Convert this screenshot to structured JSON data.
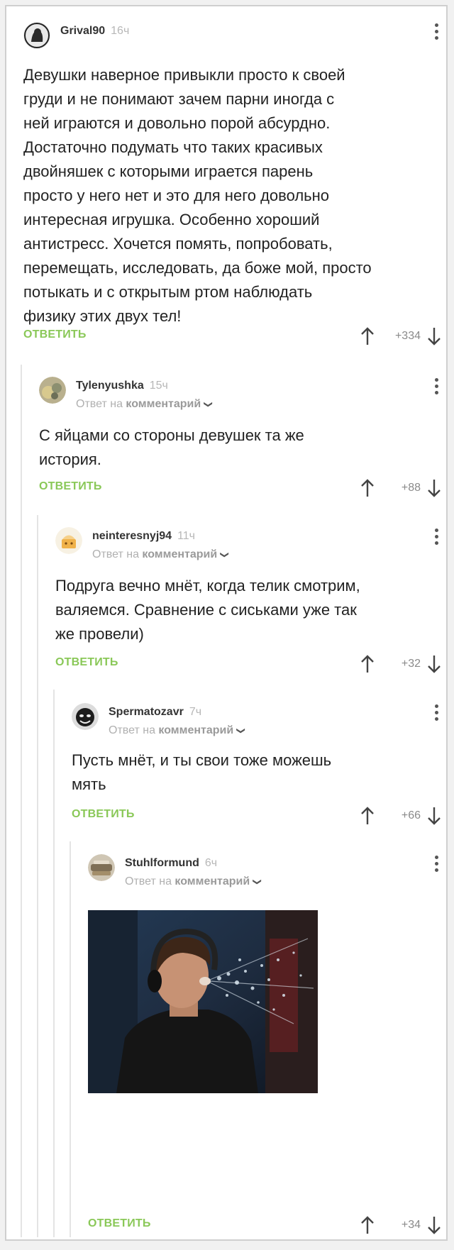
{
  "comments": [
    {
      "username": "Grival90",
      "time": "16ч",
      "reply_to": null,
      "text": "Девушки наверное привыкли просто к своей\nгруди и не понимают зачем парни иногда с\nней играются и довольно порой абсурдно.\nДостаточно подумать что таких красивых\nдвойняшек с которыми играется парень\nпросто у него нет и это для него довольно\nинтересная игрушка. Особенно хороший\nантистресс. Хочется помять, попробовать,\nперемещать, исследовать, да боже мой, просто\nпотыкать и с открытым ртом наблюдать\nфизику этих двух тел!",
      "reply_label": "ОТВЕТИТЬ",
      "rating": "+334"
    },
    {
      "username": "Tylenyushka",
      "time": "15ч",
      "reply_to": {
        "prefix": "Ответ на",
        "target": "комментарий"
      },
      "text": "С яйцами со стороны девушек та же\nистория.",
      "reply_label": "ОТВЕТИТЬ",
      "rating": "+88"
    },
    {
      "username": "neinteresnyj94",
      "time": "11ч",
      "reply_to": {
        "prefix": "Ответ на",
        "target": "комментарий"
      },
      "text": "Подруга вечно мнёт, когда телик смотрим,\nваляемся. Сравнение с сиськами уже так\nже провели)",
      "reply_label": "ОТВЕТИТЬ",
      "rating": "+32"
    },
    {
      "username": "Spermatozavr",
      "time": "7ч",
      "reply_to": {
        "prefix": "Ответ на",
        "target": "комментарий"
      },
      "text": "Пусть мнёт, и ты свои тоже можешь\nмять",
      "reply_label": "ОТВЕТИТЬ",
      "rating": "+66"
    },
    {
      "username": "Stuhlformund",
      "time": "6ч",
      "reply_to": {
        "prefix": "Ответ на",
        "target": "комментарий"
      },
      "text": "",
      "reply_label": "ОТВЕТИТЬ",
      "rating": "+34"
    }
  ],
  "icons": {
    "menu": "kebab-menu-icon",
    "upvote": "arrow-up-icon",
    "downvote": "arrow-down-icon",
    "chevron": "chevron-down-icon"
  },
  "colors": {
    "reply_green": "#8ac858",
    "meta_gray": "#b0b0b0",
    "text": "#222222"
  }
}
